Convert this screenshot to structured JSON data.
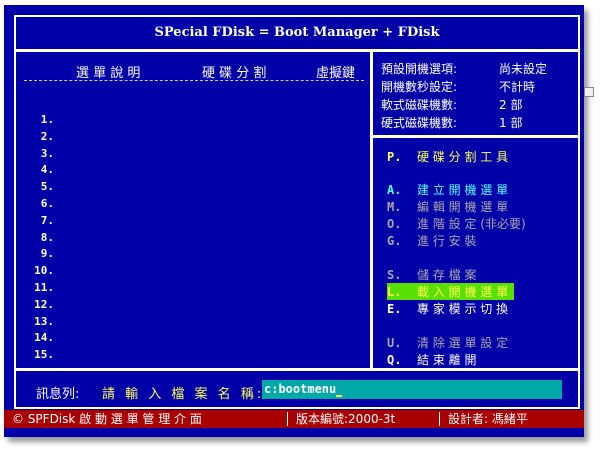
{
  "title": "SPecial FDisk = Boot Manager + FDisk",
  "list_header": {
    "menu_desc": "選 單 說 明",
    "partition": "硬 碟 分 割",
    "virtual_key": "虛擬鍵"
  },
  "rows": [
    "1.",
    "2.",
    "3.",
    "4.",
    "5.",
    "6.",
    "7.",
    "8.",
    "9.",
    "10.",
    "11.",
    "12.",
    "13.",
    "14.",
    "15."
  ],
  "info": [
    {
      "label": "預設開機選項:",
      "value": "尚未設定"
    },
    {
      "label": "開機數秒設定:",
      "value": "不計時"
    },
    {
      "label": "軟式磁碟機數:",
      "value": "2 部"
    },
    {
      "label": "硬式磁碟機數:",
      "value": "1 部"
    }
  ],
  "menu": [
    {
      "key": "P.",
      "label": "硬 碟 分 割 工 具",
      "color": "#ffff55",
      "highlighted": false
    },
    {
      "key": "A.",
      "label": "建 立 開 機 選 單",
      "color": "#55ffff",
      "highlighted": false
    },
    {
      "key": "M.",
      "label": "編 輯 開 機 選 單",
      "color": "#a8a8a8",
      "highlighted": false
    },
    {
      "key": "O.",
      "label": "進 階 設 定 (非必要)",
      "color": "#a8a8a8",
      "highlighted": false
    },
    {
      "key": "G.",
      "label": "進 行 安 裝",
      "color": "#a8a8a8",
      "highlighted": false
    },
    {
      "key": "S.",
      "label": "儲 存 檔 案",
      "color": "#a8a8a8",
      "highlighted": false
    },
    {
      "key": "L.",
      "label": "載 入 開 機 選 單",
      "color": "#ffff55",
      "highlighted": true
    },
    {
      "key": "E.",
      "label": "專 家 模 示 切 換",
      "color": "#ffffff",
      "highlighted": false
    },
    {
      "key": "U.",
      "label": "清 除 選 單 設 定",
      "color": "#a8a8a8",
      "highlighted": false
    },
    {
      "key": "Q.",
      "label": "結 束 離 開",
      "color": "#ffffff",
      "highlighted": false
    }
  ],
  "message": {
    "label": "訊息列:",
    "prompt": "請 輸 入 檔 案 名 稱:",
    "input_value": "c:bootmenu"
  },
  "status": {
    "app": "© SPFDisk 啟 動 選 單 管 理 介 面",
    "version": "版本編號:2000-3t",
    "author": "設計者: 馮緒平"
  },
  "colors": {
    "background": "#0000a8",
    "status_bar": "#a80000",
    "highlight": "#59e000",
    "input_bg": "#00a8a8"
  }
}
